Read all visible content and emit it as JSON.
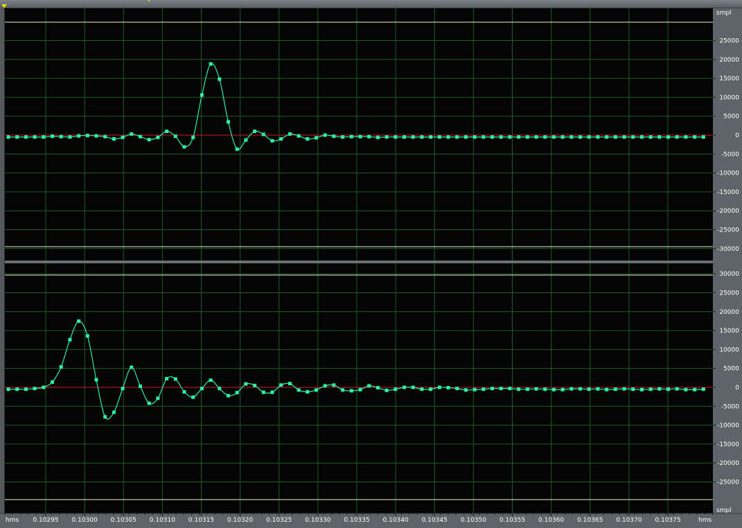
{
  "ruler": {
    "units_left": "hms",
    "units_right": "hms",
    "ticks": [
      "0.10295",
      "0.10300",
      "0.10305",
      "0.10310",
      "0.10315",
      "0.10320",
      "0.10325",
      "0.10330",
      "0.10335",
      "0.10340",
      "0.10345",
      "0.10350",
      "0.10355",
      "0.10360",
      "0.10365",
      "0.10370",
      "0.10375"
    ]
  },
  "channels": [
    {
      "unit_label": "smpl",
      "yticks": [
        "25000",
        "20000",
        "15000",
        "10000",
        "5000",
        "0",
        "-5000",
        "-10000",
        "-15000",
        "-20000",
        "-25000",
        "-30000"
      ],
      "samples": [
        -500,
        -500,
        -500,
        -500,
        -500,
        -300,
        -400,
        -500,
        -200,
        -100,
        -200,
        -400,
        -1000,
        -600,
        300,
        -400,
        -1200,
        -600,
        1000,
        -300,
        -3100,
        -600,
        10600,
        18800,
        14800,
        3500,
        -3700,
        -1300,
        1000,
        200,
        -1500,
        -1000,
        300,
        -200,
        -1000,
        -700,
        0,
        -300,
        -500,
        -400,
        -400,
        -400,
        -600,
        -500,
        -500,
        -500,
        -500,
        -500,
        -500,
        -500,
        -500,
        -500,
        -500,
        -500,
        -500,
        -500,
        -500,
        -500,
        -500,
        -500,
        -500,
        -500,
        -500,
        -500,
        -500,
        -500,
        -500,
        -500,
        -500,
        -500,
        -500,
        -500,
        -500,
        -500,
        -500,
        -500,
        -500,
        -500,
        -500,
        -500,
        -500
      ]
    },
    {
      "unit_label": "smpl",
      "yticks": [
        "30000",
        "25000",
        "20000",
        "15000",
        "10000",
        "5000",
        "0",
        "-5000",
        "-10000",
        "-15000",
        "-20000",
        "-25000"
      ],
      "samples": [
        -500,
        -500,
        -500,
        -300,
        0,
        1400,
        5400,
        12600,
        17500,
        13600,
        2000,
        -7800,
        -6600,
        -300,
        5300,
        300,
        -4200,
        -2900,
        2300,
        2200,
        -1200,
        -2600,
        -300,
        1900,
        -300,
        -2200,
        -1400,
        900,
        500,
        -1300,
        -1300,
        600,
        1000,
        -700,
        -1200,
        -700,
        400,
        600,
        -700,
        -900,
        -600,
        400,
        -100,
        -800,
        -500,
        0,
        0,
        -500,
        -500,
        0,
        -100,
        -300,
        -700,
        -600,
        -500,
        -300,
        -300,
        -300,
        -500,
        -500,
        -400,
        -500,
        -600,
        -600,
        -400,
        -400,
        -500,
        -400,
        -600,
        -500,
        -400,
        -500,
        -600,
        -500,
        -400,
        -500,
        -400,
        -600,
        -600,
        -500,
        -500,
        -500
      ]
    }
  ],
  "colors": {
    "background": "#040404",
    "grid": "#1e5a2a",
    "waveform": "#2cf0a6",
    "zero_line": "#d01818",
    "clip_line": "#f0f0d0",
    "axis_panel": "#5f6468"
  }
}
